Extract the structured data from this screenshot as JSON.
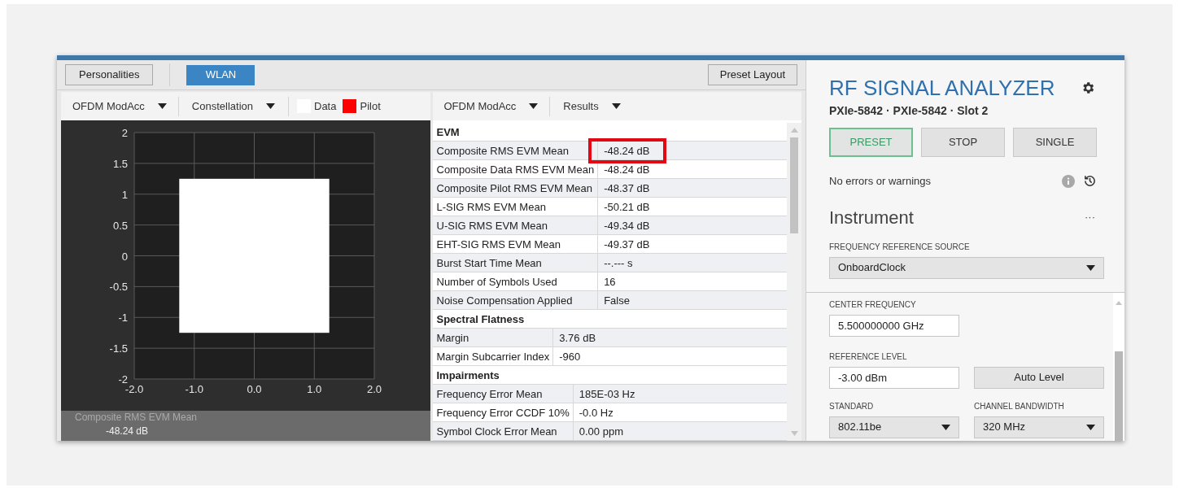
{
  "toolbar": {
    "personalities_button": "Personalities",
    "tabs": [
      {
        "label": "WLAN",
        "selected": true
      }
    ],
    "preset_layout_button": "Preset Layout"
  },
  "constellation_pane": {
    "measurement_dropdown": "OFDM ModAcc",
    "view_dropdown": "Constellation",
    "legend": [
      {
        "label": "Data",
        "color": "#ffffff"
      },
      {
        "label": "Pilot",
        "color": "#ff0000"
      }
    ],
    "y_ticks": [
      "2",
      "1.5",
      "1",
      "0.5",
      "0",
      "-0.5",
      "-1",
      "-1.5",
      "-2"
    ],
    "x_ticks": [
      "-2.0",
      "-1.0",
      "0.0",
      "1.0",
      "2.0"
    ],
    "readout_label": "Composite RMS EVM Mean",
    "readout_value": "-48.24 dB"
  },
  "results_pane": {
    "measurement_dropdown": "OFDM ModAcc",
    "view_dropdown": "Results",
    "sections": [
      {
        "title": "EVM",
        "rows": [
          {
            "label": "Composite RMS EVM Mean",
            "value": "-48.24 dB",
            "highlighted": true
          },
          {
            "label": "Composite Data RMS EVM Mean",
            "value": "-48.24 dB",
            "highlighted": false
          },
          {
            "label": "Composite Pilot RMS EVM Mean",
            "value": "-48.37 dB",
            "highlighted": false
          },
          {
            "label": "L-SIG RMS EVM Mean",
            "value": "-50.21 dB",
            "highlighted": false
          },
          {
            "label": "U-SIG RMS EVM Mean",
            "value": "-49.34 dB",
            "highlighted": false
          },
          {
            "label": "EHT-SIG RMS EVM Mean",
            "value": "-49.37 dB",
            "highlighted": false
          },
          {
            "label": "Burst Start Time Mean",
            "value": "--.--- s",
            "highlighted": false
          },
          {
            "label": "Number of Symbols Used",
            "value": "16",
            "highlighted": false
          },
          {
            "label": "Noise Compensation Applied",
            "value": "False",
            "highlighted": false
          }
        ]
      },
      {
        "title": "Spectral Flatness",
        "rows": [
          {
            "label": "Margin",
            "value": "3.76 dB",
            "highlighted": false
          },
          {
            "label": "Margin Subcarrier Index",
            "value": "-960",
            "highlighted": false
          }
        ]
      },
      {
        "title": "Impairments",
        "rows": [
          {
            "label": "Frequency Error Mean",
            "value": "185E-03 Hz",
            "highlighted": false
          },
          {
            "label": "Frequency Error CCDF 10%",
            "value": "-0.0 Hz",
            "highlighted": false
          },
          {
            "label": "Symbol Clock Error Mean",
            "value": "0.00 ppm",
            "highlighted": false
          }
        ]
      }
    ]
  },
  "instrument_panel": {
    "title": "RF SIGNAL ANALYZER",
    "subtitle": "PXIe-5842 · PXIe-5842 · Slot 2",
    "buttons": [
      {
        "label": "PRESET",
        "selected": true
      },
      {
        "label": "STOP",
        "selected": false
      },
      {
        "label": "SINGLE",
        "selected": false
      }
    ],
    "status": "No errors or warnings",
    "section_title": "Instrument",
    "more_menu": "···",
    "frequency_reference_source": {
      "label": "FREQUENCY REFERENCE SOURCE",
      "value": "OnboardClock"
    },
    "center_frequency": {
      "label": "CENTER FREQUENCY",
      "value": "5.500000000 GHz"
    },
    "reference_level": {
      "label": "REFERENCE LEVEL",
      "value": "-3.00 dBm"
    },
    "auto_level_button": "Auto Level",
    "standard": {
      "label": "STANDARD",
      "value": "802.11be"
    },
    "channel_bandwidth": {
      "label": "CHANNEL BANDWIDTH",
      "value": "320 MHz"
    }
  }
}
